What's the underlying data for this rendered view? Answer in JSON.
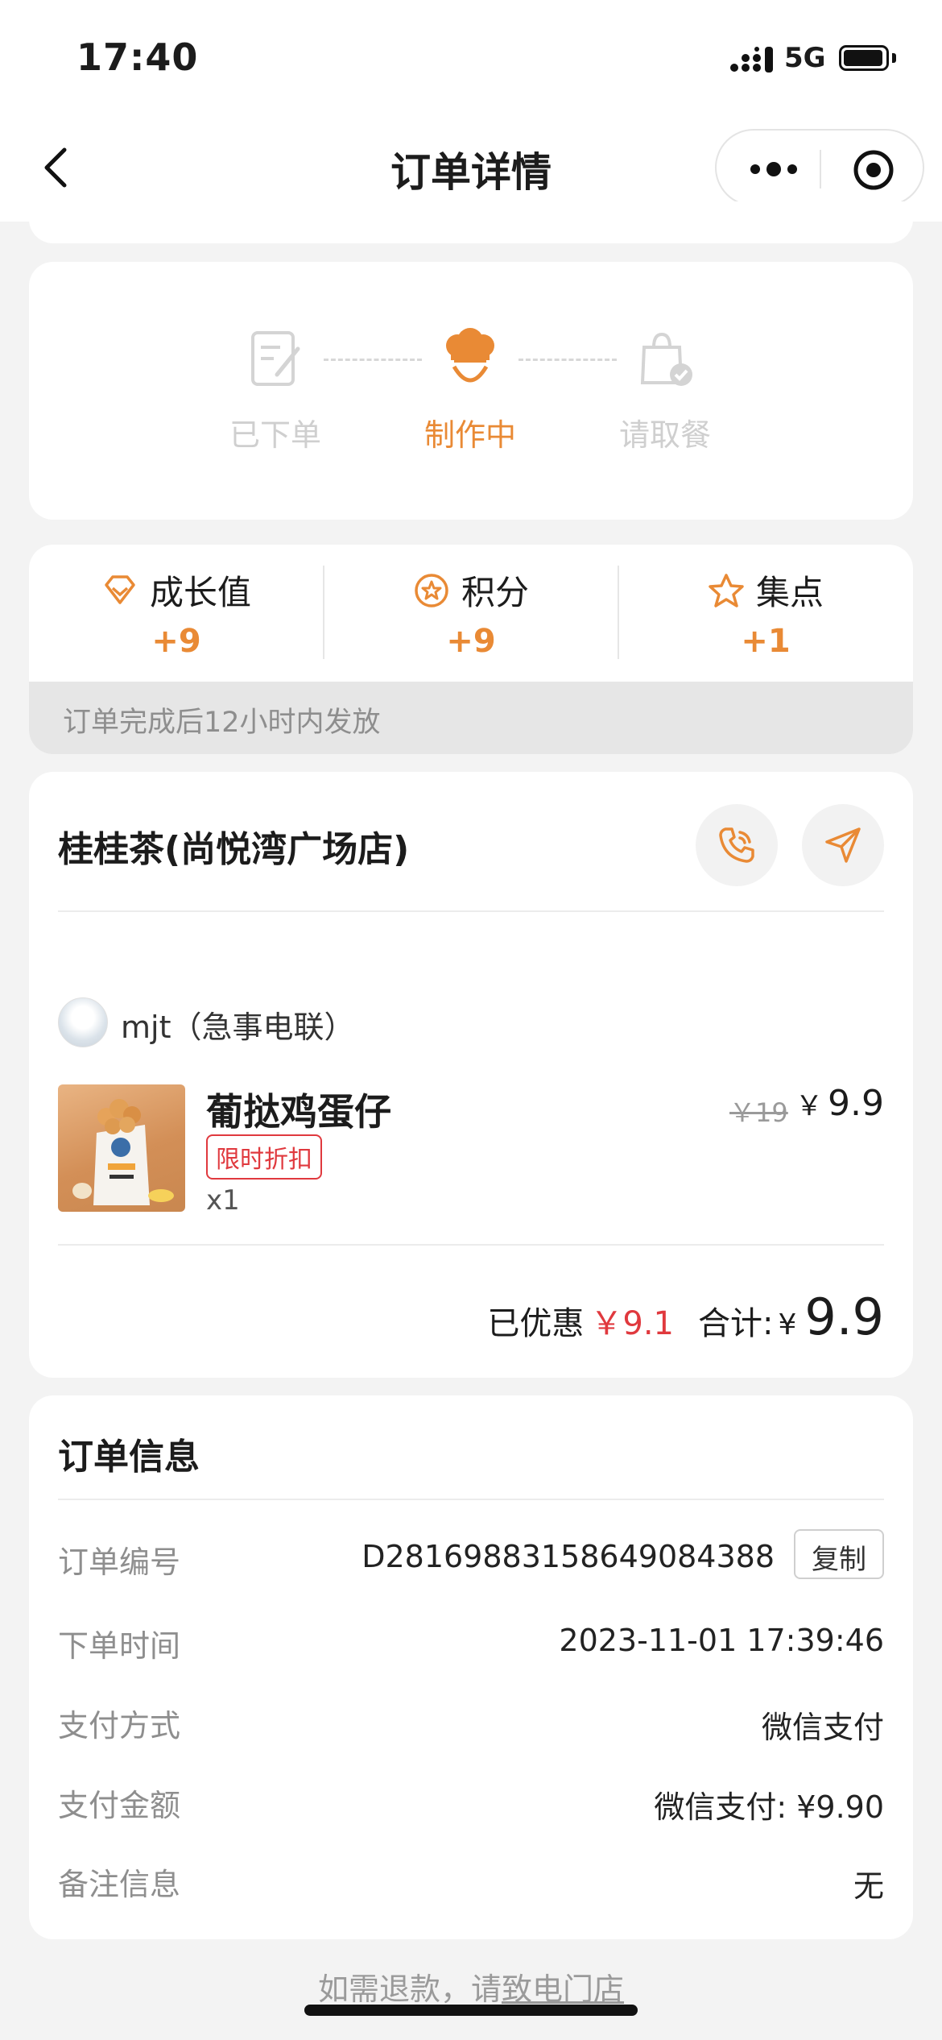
{
  "status_bar": {
    "time": "17:40",
    "network": "5G"
  },
  "nav": {
    "title": "订单详情"
  },
  "progress": {
    "steps": [
      {
        "label": "已下单",
        "state": "done",
        "icon": "order-note-icon"
      },
      {
        "label": "制作中",
        "state": "active",
        "icon": "chef-hat-icon"
      },
      {
        "label": "请取餐",
        "state": "pending",
        "icon": "pickup-bag-icon"
      }
    ]
  },
  "rewards": {
    "items": [
      {
        "label": "成长值",
        "value": "+9",
        "icon": "diamond-icon"
      },
      {
        "label": "积分",
        "value": "+9",
        "icon": "points-star-circle-icon"
      },
      {
        "label": "集点",
        "value": "+1",
        "icon": "star-outline-icon"
      }
    ],
    "note": "订单完成后12小时内发放"
  },
  "store": {
    "name": "桂桂茶(尚悦湾广场店)"
  },
  "order": {
    "user": "mjt（急事电联）",
    "product": {
      "name": "葡挞鸡蛋仔",
      "tag": "限时折扣",
      "qty": "x1",
      "old_price": "￥19",
      "currency": "￥",
      "price": "9.9"
    },
    "totals": {
      "discount_label": "已优惠",
      "discount_value": "￥9.1",
      "total_label": "合计:",
      "currency": "¥",
      "total_value": "9.9"
    }
  },
  "info": {
    "title": "订单信息",
    "rows": [
      {
        "label": "订单编号",
        "value": "D28169883158649084388"
      },
      {
        "label": "下单时间",
        "value": "2023-11-01 17:39:46"
      },
      {
        "label": "支付方式",
        "value": "微信支付"
      },
      {
        "label": "支付金额",
        "value": "微信支付: ¥9.90"
      },
      {
        "label": "备注信息",
        "value": "无"
      }
    ],
    "copy_label": "复制"
  },
  "footer": {
    "refund_prefix": "如需退款，请",
    "refund_link": "致电门店"
  },
  "colors": {
    "accent": "#e98a35",
    "red": "#e0393e",
    "muted": "#cfcfcf"
  }
}
